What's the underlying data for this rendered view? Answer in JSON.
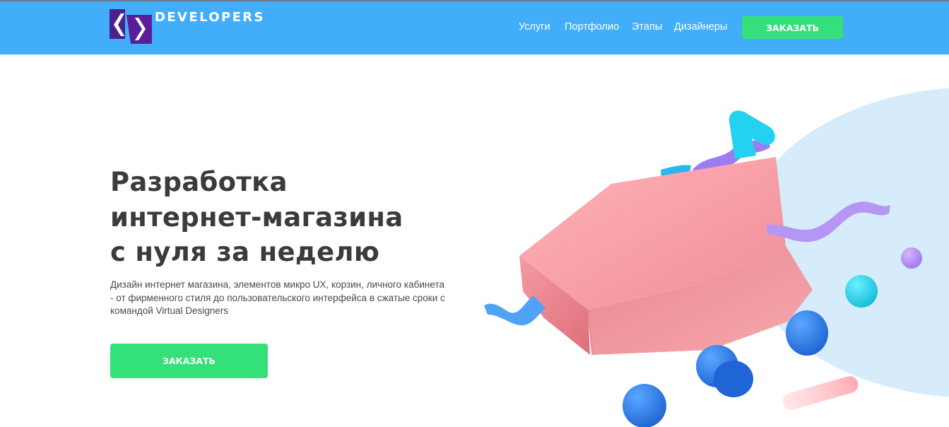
{
  "header": {
    "logo_text": "DEVELOPERS",
    "nav": [
      {
        "label": "Услуги"
      },
      {
        "label": "Портфолио"
      },
      {
        "label": "Этапы"
      },
      {
        "label": "Дизайнеры"
      }
    ],
    "order_label": "ЗАКАЗАТЬ"
  },
  "hero": {
    "title_lines": [
      "Разработка",
      "интернет-магазина",
      "с нуля за неделю"
    ],
    "description": "Дизайн интернет магазина, элементов микро UX, корзин, личного кабинета - от фирменного стиля до пользовательского интерфейса в сжатые сроки с командой Virtual Designers",
    "order_label": "ЗАКАЗАТЬ"
  },
  "colors": {
    "header_bg": "#42adf8",
    "accent_green": "#33e07a",
    "logo_purple": "#6a1fa0",
    "blob_bg": "#d6ecfb",
    "cube_pink": "#f39ba3"
  },
  "icons": {
    "logo": "code-brackets-icon",
    "illustration": "3d-cube-illustration"
  }
}
